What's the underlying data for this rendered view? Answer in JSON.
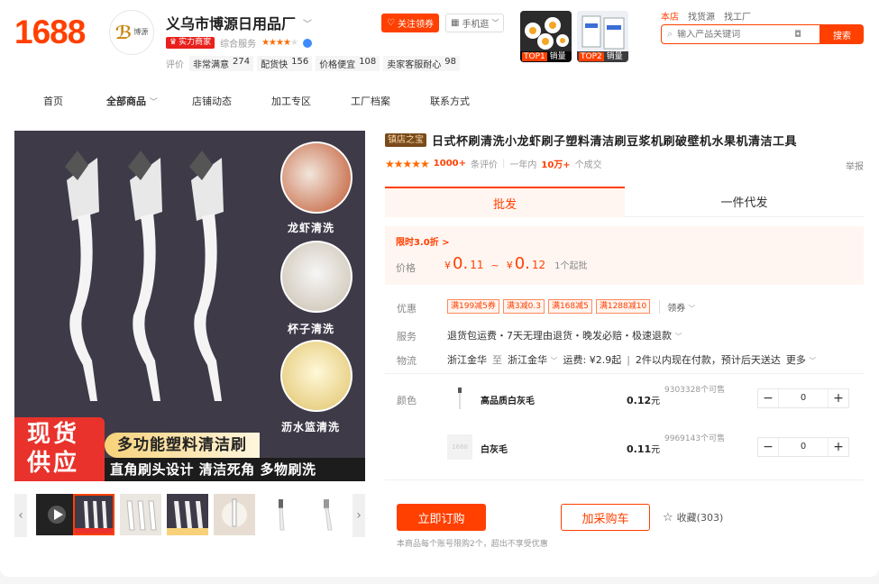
{
  "header": {
    "logo": "1688",
    "shop_logo_text": "博源",
    "shop_name": "义乌市博源日用品厂",
    "strength_badge": "实力商家",
    "overall_service_label": "综合服务",
    "service_stars": 4,
    "ratings_label": "评价",
    "ratings": [
      {
        "label": "非常满意",
        "value": "274"
      },
      {
        "label": "配货快",
        "value": "156"
      },
      {
        "label": "价格便宜",
        "value": "108"
      },
      {
        "label": "卖家客服耐心",
        "value": "98"
      }
    ],
    "follow_label": "关注领券",
    "mobile_label": "手机逛",
    "top_items": [
      {
        "rank": "TOP1",
        "suffix": "销量"
      },
      {
        "rank": "TOP2",
        "suffix": "销量"
      }
    ],
    "search_tabs": [
      "本店",
      "找货源",
      "找工厂"
    ],
    "search_placeholder": "输入产品关键词",
    "search_button": "搜索"
  },
  "nav": [
    "首页",
    "全部商品",
    "店铺动态",
    "加工专区",
    "工厂档案",
    "联系方式"
  ],
  "gallery": {
    "circle_labels": [
      "龙虾清洗",
      "杯子清洗",
      "沥水篮清洗"
    ],
    "banner_left": "现货供应",
    "banner_top": "多功能塑料清洁刷",
    "banner_bottom": "直角刷头设计 清洁死角 多物刷洗"
  },
  "product": {
    "store_tag": "镇店之宝",
    "title": "日式杯刷清洗小龙虾刷子塑料清洁刷豆浆机刷破壁机水果机清洁工具",
    "rating_stars": 5,
    "review_count": "1000+",
    "review_label": "条评价",
    "period_label": "一年内",
    "sold_count": "10万+",
    "sold_label": "个成交",
    "report_label": "举报",
    "tabs": [
      "批发",
      "一件代发"
    ],
    "promo": "限时3.0折 >",
    "price_label": "价格",
    "price_low_int": "0.",
    "price_low_dec": "11",
    "price_high_int": "0.",
    "price_high_dec": "12",
    "currency": "¥",
    "price_sep": "~",
    "moq": "1个起批",
    "coupon_label": "优惠",
    "coupons": [
      "满199减5券",
      "满3减0.3",
      "满168减5",
      "满1288减10"
    ],
    "coupon_more": "领券",
    "service_label": "服务",
    "service_text": "退货包运费・7天无理由退货・晚发必赔・极速退款",
    "logistics_label": "物流",
    "logistics_from": "浙江金华",
    "logistics_to_word": "至",
    "logistics_to": "浙江金华",
    "freight": "运费: ¥2.9起",
    "delivery": "2件以内现在付款，预计后天送达",
    "more": "更多",
    "color_label": "颜色",
    "colors": [
      {
        "name": "高品质白灰毛",
        "price": "0.12",
        "unit": "元",
        "stock": "9303328个可售",
        "qty": "0"
      },
      {
        "name": "白灰毛",
        "price": "0.11",
        "unit": "元",
        "stock": "9969143个可售",
        "qty": "0"
      }
    ],
    "buy_now": "立即订购",
    "add_cart": "加采购车",
    "favorite": "收藏(303)",
    "notice": "本商品每个账号限购2个，超出不享受优惠"
  }
}
